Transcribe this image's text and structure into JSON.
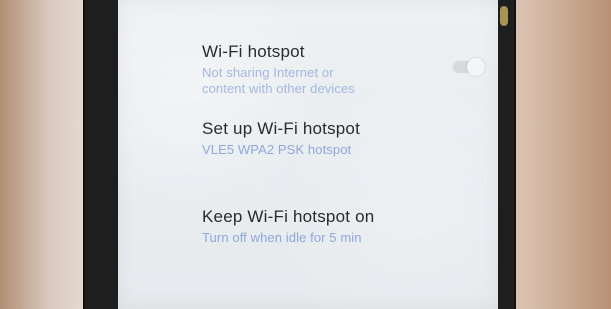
{
  "settings": {
    "items": [
      {
        "title": "Wi-Fi hotspot",
        "subtitle": "Not sharing Internet or\ncontent with other devices"
      },
      {
        "title": "Set up Wi-Fi hotspot",
        "subtitle": "VLE5 WPA2 PSK hotspot"
      },
      {
        "title": "Keep Wi-Fi hotspot on",
        "subtitle": "Turn off when idle for 5 min"
      }
    ],
    "hotspot_toggle_state": "off"
  },
  "colors": {
    "title_text": "#2b2b2b",
    "subtitle_text": "#8ea7dc",
    "screen_background": "#eef1f3",
    "phone_frame": "#1e1e1e",
    "toggle_track_off": "#d8d9dc"
  },
  "icons": {
    "toggle": "toggle-switch-icon"
  }
}
